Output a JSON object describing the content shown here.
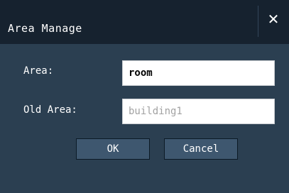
{
  "dialog": {
    "title": "Area Manage",
    "close_glyph": "✕",
    "close_icon": "close-icon"
  },
  "form": {
    "area_label": "Area:",
    "area_value": "room",
    "old_area_label": "Old Area:",
    "old_area_value": "building1"
  },
  "buttons": {
    "ok_label": "OK",
    "cancel_label": "Cancel"
  },
  "colors": {
    "titlebar": "#16222f",
    "body": "#2b3f51",
    "button": "#3e576f"
  }
}
